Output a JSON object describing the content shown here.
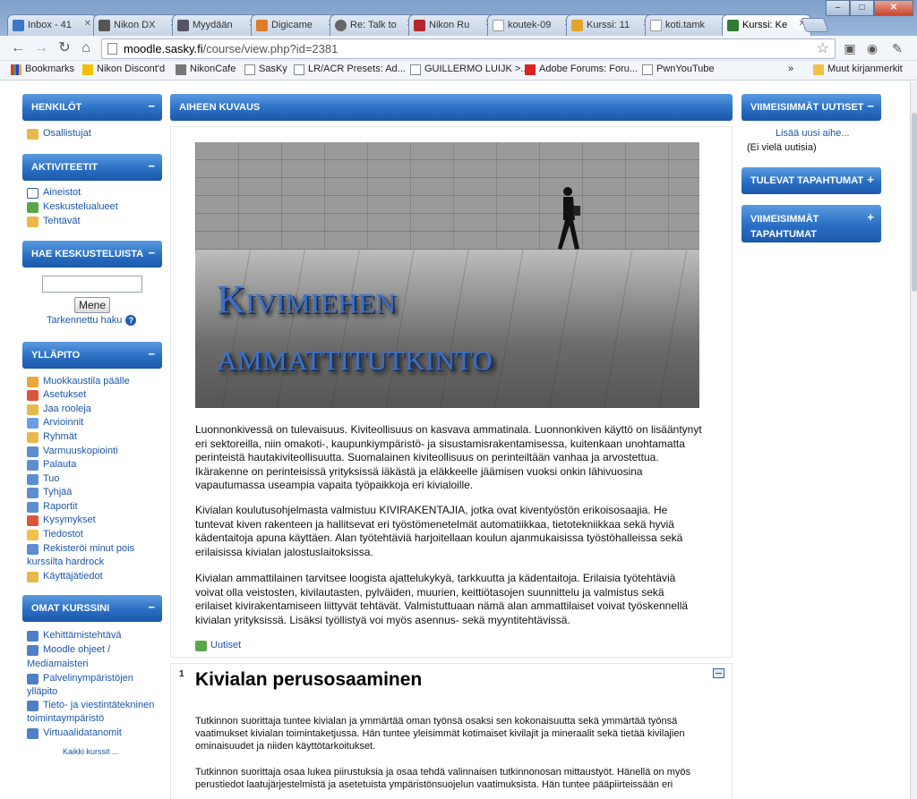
{
  "browser": {
    "tabs": [
      {
        "label": "Inbox - 41",
        "color": "#3a78c8"
      },
      {
        "label": "Nikon DX",
        "color": "#555555"
      },
      {
        "label": "Myydään",
        "color": "#555555"
      },
      {
        "label": "Digicame",
        "color": "#e07b2a"
      },
      {
        "label": "Re: Talk to",
        "color": "#555555"
      },
      {
        "label": "Nikon Ru",
        "color": "#b3262b"
      },
      {
        "label": "koutek-09",
        "color": "#ffffff"
      },
      {
        "label": "Kurssi: 11",
        "color": "#e0a52a"
      },
      {
        "label": "koti.tamk",
        "color": "#ffffff"
      },
      {
        "label": "Kurssi: Ke",
        "color": "#2e7d32"
      }
    ],
    "window_buttons": {
      "minimize": "‒",
      "maximize": "□",
      "close": "✕"
    },
    "url_host": "moodle.sasky.fi",
    "url_path": "/course/view.php?id=2381",
    "bookmarks": [
      {
        "label": "Bookmarks"
      },
      {
        "label": "Nikon Discont'd"
      },
      {
        "label": "NikonCafe"
      },
      {
        "label": "SasKy"
      },
      {
        "label": "LR/ACR Presets: Ad..."
      },
      {
        "label": "GUILLERMO LUIJK >..."
      },
      {
        "label": "Adobe Forums: Foru..."
      },
      {
        "label": "PwnYouTube"
      }
    ],
    "bookmarks_overflow": "»",
    "other_bookmarks": "Muut kirjanmerkit"
  },
  "left": {
    "henkilot": {
      "title": "HENKILÖT",
      "items": [
        "Osallistujat"
      ]
    },
    "aktiviteetit": {
      "title": "AKTIVITEETIT",
      "items": [
        "Aineistot",
        "Keskustelualueet",
        "Tehtävät"
      ]
    },
    "hae": {
      "title": "HAE KESKUSTELUISTA",
      "button": "Mene",
      "advanced": "Tarkennettu haku"
    },
    "yllapito": {
      "title": "YLLÄPITO",
      "items": [
        "Muokkaustila päälle",
        "Asetukset",
        "Jaa rooleja",
        "Arvioinnit",
        "Ryhmät",
        "Varmuuskopiointi",
        "Palauta",
        "Tuo",
        "Tyhjää",
        "Raportit",
        "Kysymykset",
        "Tiedostot",
        "Rekisteröi minut pois",
        "kurssilta hardrock",
        "Käyttäjätiedot"
      ]
    },
    "omat": {
      "title": "OMAT KURSSINI",
      "items": [
        "Kehittämistehtävä",
        "Moodle ohjeet /",
        "Mediamaisteri",
        "Palvelinympäristöjen",
        "ylläpito",
        "Tieto- ja viestintätekninen",
        "toimintaympäristö",
        "Virtuaalidatanomit"
      ],
      "all": "Kaikki kurssit ..."
    }
  },
  "main": {
    "header": "AIHEEN KUVAUS",
    "hero_line1": "Kivimiehen",
    "hero_line2": "ammattitutkinto",
    "paragraphs": [
      "Luonnonkivessä on tulevaisuus. Kiviteollisuus on kasvava ammatinala. Luonnonkiven käyttö on lisääntynyt eri sektoreilla, niin omakoti-, kaupunkiympäristö- ja sisustamisrakentamisessa, kuitenkaan unohtamatta perinteistä hautakiviteollisuutta. Suomalainen kiviteollisuus on perinteiltään vanhaa ja arvostettua. Ikärakenne on perinteisissä yrityksissä iäkästä ja eläkkeelle jäämisen vuoksi onkin lähivuosina vapautumassa useampia vapaita työpaikkoja eri kivialoille.",
      "Kivialan koulutusohjelmasta valmistuu KIVIRAKENTAJIA, jotka ovat kiventyöstön erikoisosaajia. He tuntevat kiven rakenteen ja hallitsevat eri työstömenetelmät automatiikkaa, tietotekniikkaa sekä hyviä kädentaitoja apuna käyttäen. Alan työtehtäviä harjoitellaan koulun ajanmukaisissa työstöhalleissa sekä erilaisissa kivialan jalostuslaitoksissa.",
      "Kivialan ammattilainen tarvitsee loogista ajattelukykyä, tarkkuutta ja kädentaitoja. Erilaisia työtehtäviä voivat olla veistosten, kivilautasten, pylväiden, muurien, keittiötasojen suunnittelu ja valmistus sekä erilaiset kivirakentamiseen liittyvät tehtävät. Valmistuttuaan nämä alan ammattilaiset voivat työskennellä kivialan yrityksissä. Lisäksi työllistyä voi myös asennus- sekä myyntitehtävissä."
    ],
    "news_link": "Uutiset",
    "section_number": "1",
    "section_title": "Kivialan perusosaaminen",
    "section_paragraphs": [
      "Tutkinnon suorittaja tuntee kivialan ja ymmärtää oman työnsä osaksi sen kokonaisuutta sekä ymmärtää työnsä vaatimukset kivialan toimintaketjussa. Hän tuntee yleisimmät kotimaiset kivilajit ja mineraalit sekä tietää kivilajien ominaisuudet ja niiden käyttötarkoitukset.",
      "Tutkinnon suorittaja osaa lukea piirustuksia ja osaa tehdä valinnaisen tutkinnonosan mittaustyöt. Hänellä on myös perustiedot laatujärjestelmistä ja asetetuista ympäristönsuojelun vaatimuksista. Hän tuntee pääpiirteissään eri"
    ]
  },
  "right": {
    "uutiset": {
      "title": "VIIMEISIMMÄT UUTISET",
      "add": "Lisää uusi aihe...",
      "empty": "(Ei vielä uutisia)"
    },
    "tulevat": {
      "title": "TULEVAT TAPAHTUMAT"
    },
    "tapahtumat": {
      "title_line1": "VIIMEISIMMÄT",
      "title_line2": "TAPAHTUMAT"
    }
  }
}
